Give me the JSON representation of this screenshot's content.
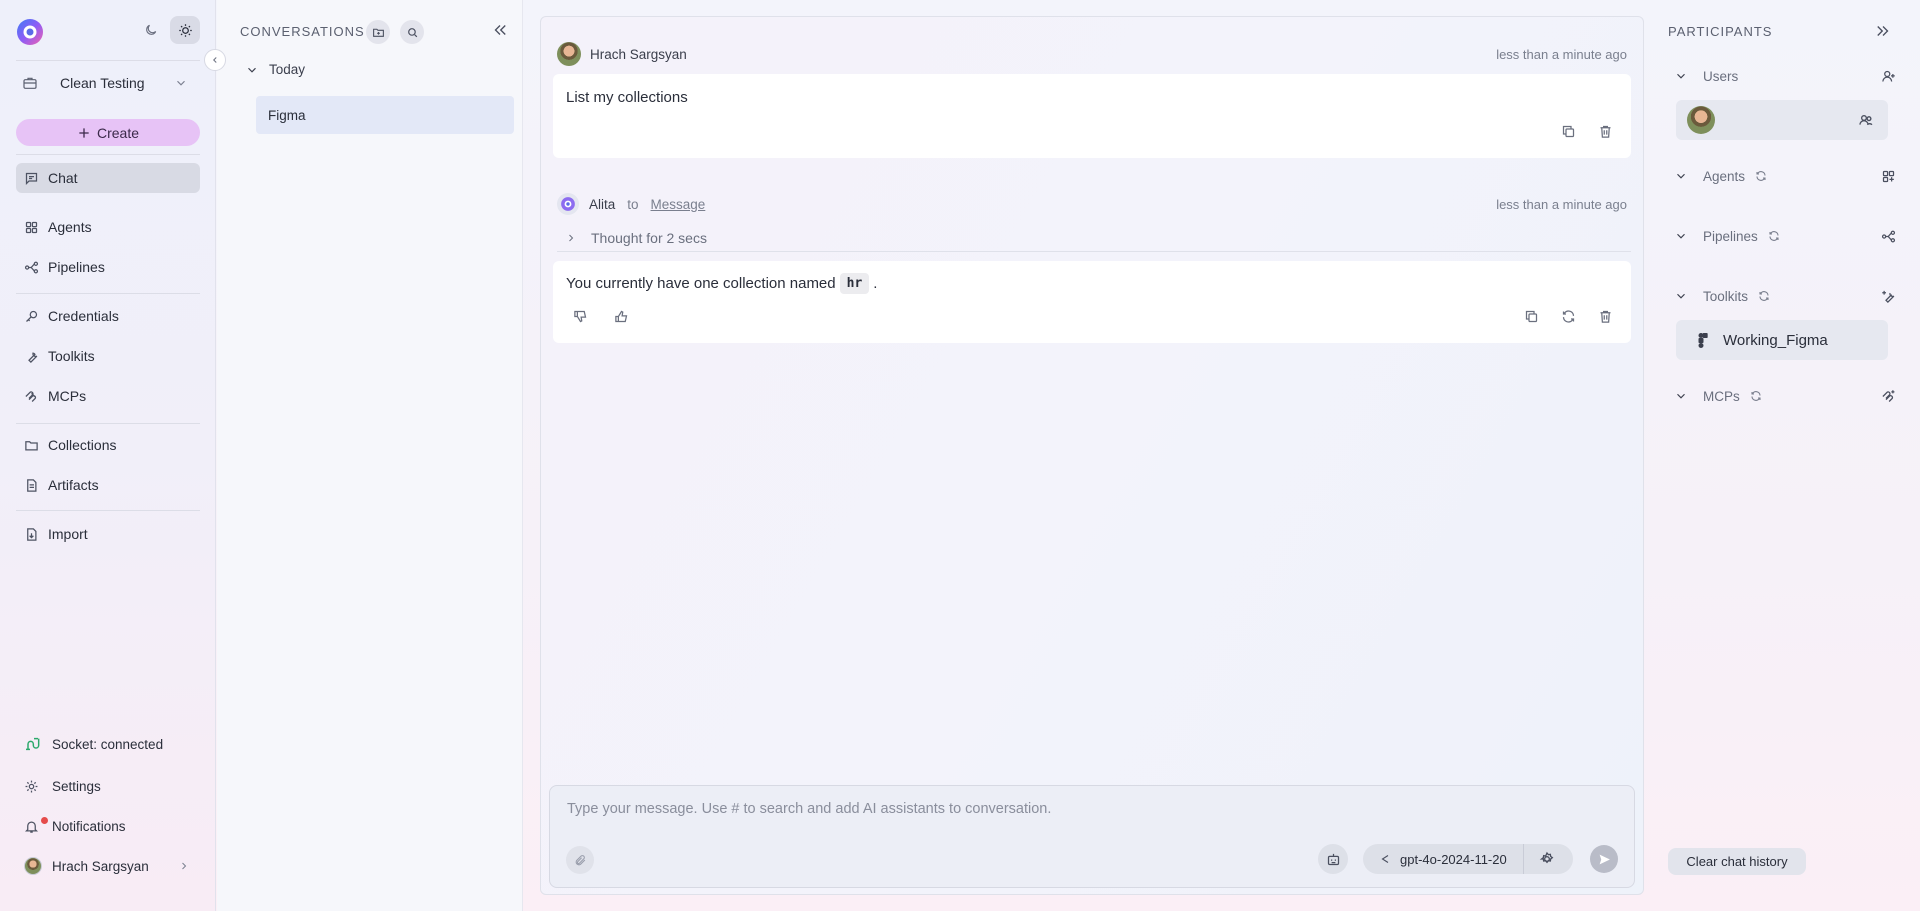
{
  "sidebar": {
    "project": "Clean Testing",
    "create_label": "Create",
    "nav": [
      {
        "label": "Chat",
        "icon": "chat-icon"
      },
      {
        "label": "Agents",
        "icon": "grid-icon"
      },
      {
        "label": "Pipelines",
        "icon": "pipeline-icon"
      },
      {
        "label": "Credentials",
        "icon": "key-icon"
      },
      {
        "label": "Toolkits",
        "icon": "wrench-icon"
      },
      {
        "label": "MCPs",
        "icon": "mcp-icon"
      },
      {
        "label": "Collections",
        "icon": "folder-icon"
      },
      {
        "label": "Artifacts",
        "icon": "file-icon"
      },
      {
        "label": "Import",
        "icon": "import-icon"
      }
    ],
    "active_nav": "Chat",
    "socket_status": "Socket: connected",
    "settings_label": "Settings",
    "notifications_label": "Notifications",
    "user_name": "Hrach Sargsyan"
  },
  "conversations": {
    "title": "CONVERSATIONS",
    "group_label": "Today",
    "items": [
      {
        "title": "Figma"
      }
    ]
  },
  "chat": {
    "messages": [
      {
        "author": "Hrach Sargsyan",
        "time": "less than a minute ago",
        "text": "List my collections"
      },
      {
        "author": "Alita",
        "to_label": "to",
        "target": "Message",
        "time": "less than a minute ago",
        "thought": "Thought for 2 secs",
        "text_before": "You currently have one collection named",
        "code": "hr",
        "text_after": "."
      }
    ],
    "input_placeholder": "Type your message. Use # to search and add AI assistants to conversation.",
    "model": "gpt-4o-2024-11-20"
  },
  "participants": {
    "title": "PARTICIPANTS",
    "sections": {
      "users": "Users",
      "agents": "Agents",
      "pipelines": "Pipelines",
      "toolkits": "Toolkits",
      "mcps": "MCPs"
    },
    "toolkit_items": [
      "Working_Figma"
    ],
    "clear_label": "Clear chat history"
  },
  "colors": {
    "create_button": "#e7c3f6",
    "active_nav": "#d8dae4",
    "selected_conversation": "#e3e8f7",
    "socket_icon": "#2aa86a",
    "notification_dot": "#e54b4b"
  }
}
